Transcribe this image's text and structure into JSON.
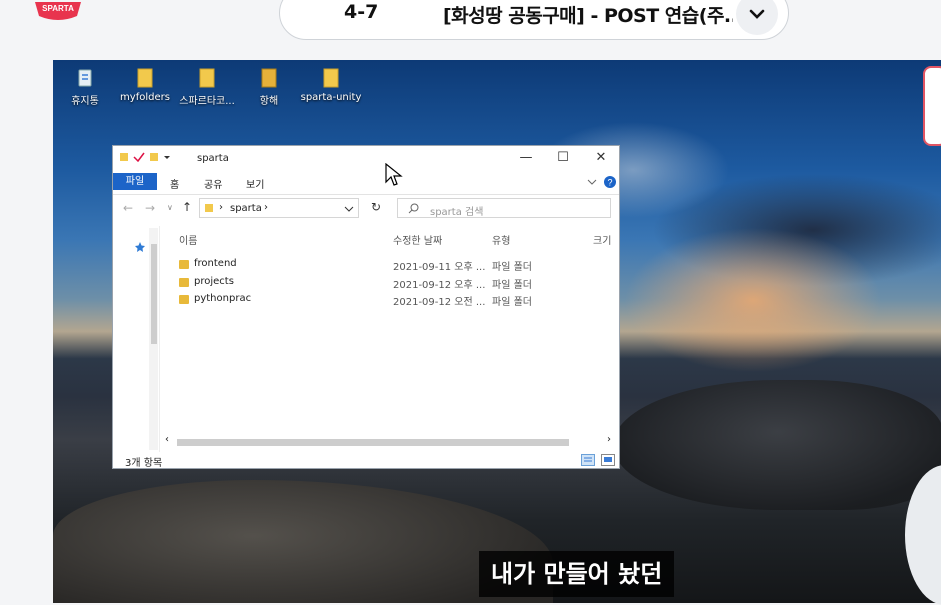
{
  "brand": {
    "logo_text": "SPARTA",
    "accent": "#e8344e"
  },
  "lesson": {
    "number": "4-7",
    "title": "[화성땅 공동구매] - POST 연습(주..."
  },
  "desktop": {
    "icons": [
      {
        "label": "휴지통",
        "icon": "recycle-bin-icon"
      },
      {
        "label": "myfolders",
        "icon": "folder-icon"
      },
      {
        "label": "스파르타코...",
        "icon": "folder-icon"
      },
      {
        "label": "항해",
        "icon": "folder-icon"
      },
      {
        "label": "sparta-unity",
        "icon": "folder-icon"
      }
    ]
  },
  "explorer": {
    "title": "sparta",
    "ribbon_tabs": [
      "파일",
      "홈",
      "공유",
      "보기"
    ],
    "path_segment": "sparta",
    "search_placeholder": "sparta 검색",
    "columns": {
      "name": "이름",
      "date": "수정한 날짜",
      "type": "유형",
      "size": "크기"
    },
    "rows": [
      {
        "name": "frontend",
        "date": "2021-09-11 오후 ...",
        "type": "파일 폴더"
      },
      {
        "name": "projects",
        "date": "2021-09-12 오후 ...",
        "type": "파일 폴더"
      },
      {
        "name": "pythonprac",
        "date": "2021-09-12 오전 ...",
        "type": "파일 폴더"
      }
    ],
    "status": "3개 항목"
  },
  "subtitle": "내가 만들어 놨던"
}
